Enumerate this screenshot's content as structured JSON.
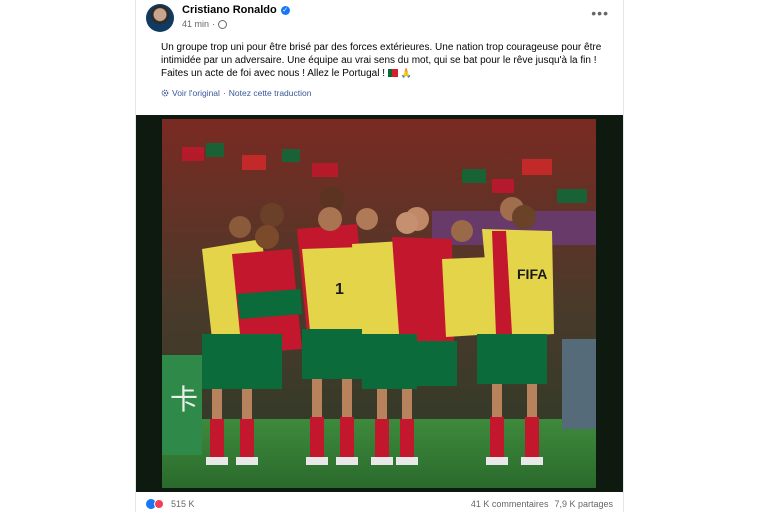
{
  "post": {
    "author": "Cristiano Ronaldo",
    "time": "41 min",
    "separator": "·",
    "text": "Un groupe trop uni pour être brisé par des forces extérieures. Une nation trop courageuse pour être intimidée par un adversaire. Une équipe au vrai sens du mot, qui se bat pour le rêve jusqu'à la fin ! Faites un acte de foi avec nous ! Allez le Portugal !",
    "text_emojis": [
      "flag-portugal",
      "folded-hands"
    ],
    "see_original": "Voir l'original",
    "rate_translation": "Notez cette traduction",
    "translation_separator": " · "
  },
  "photo": {
    "jersey_text": "FIFA",
    "number": "1"
  },
  "footer": {
    "reactions_count": "515 K",
    "comments": "41 K commentaires",
    "shares": "7,9 K partages"
  },
  "colors": {
    "link": "#385898",
    "brand_blue": "#1877f2",
    "love_red": "#f33e58",
    "jersey_red": "#c2172d",
    "jersey_green": "#0b6b3a",
    "bib_yellow": "#e4d44a",
    "pitch": "#2f7a35"
  }
}
